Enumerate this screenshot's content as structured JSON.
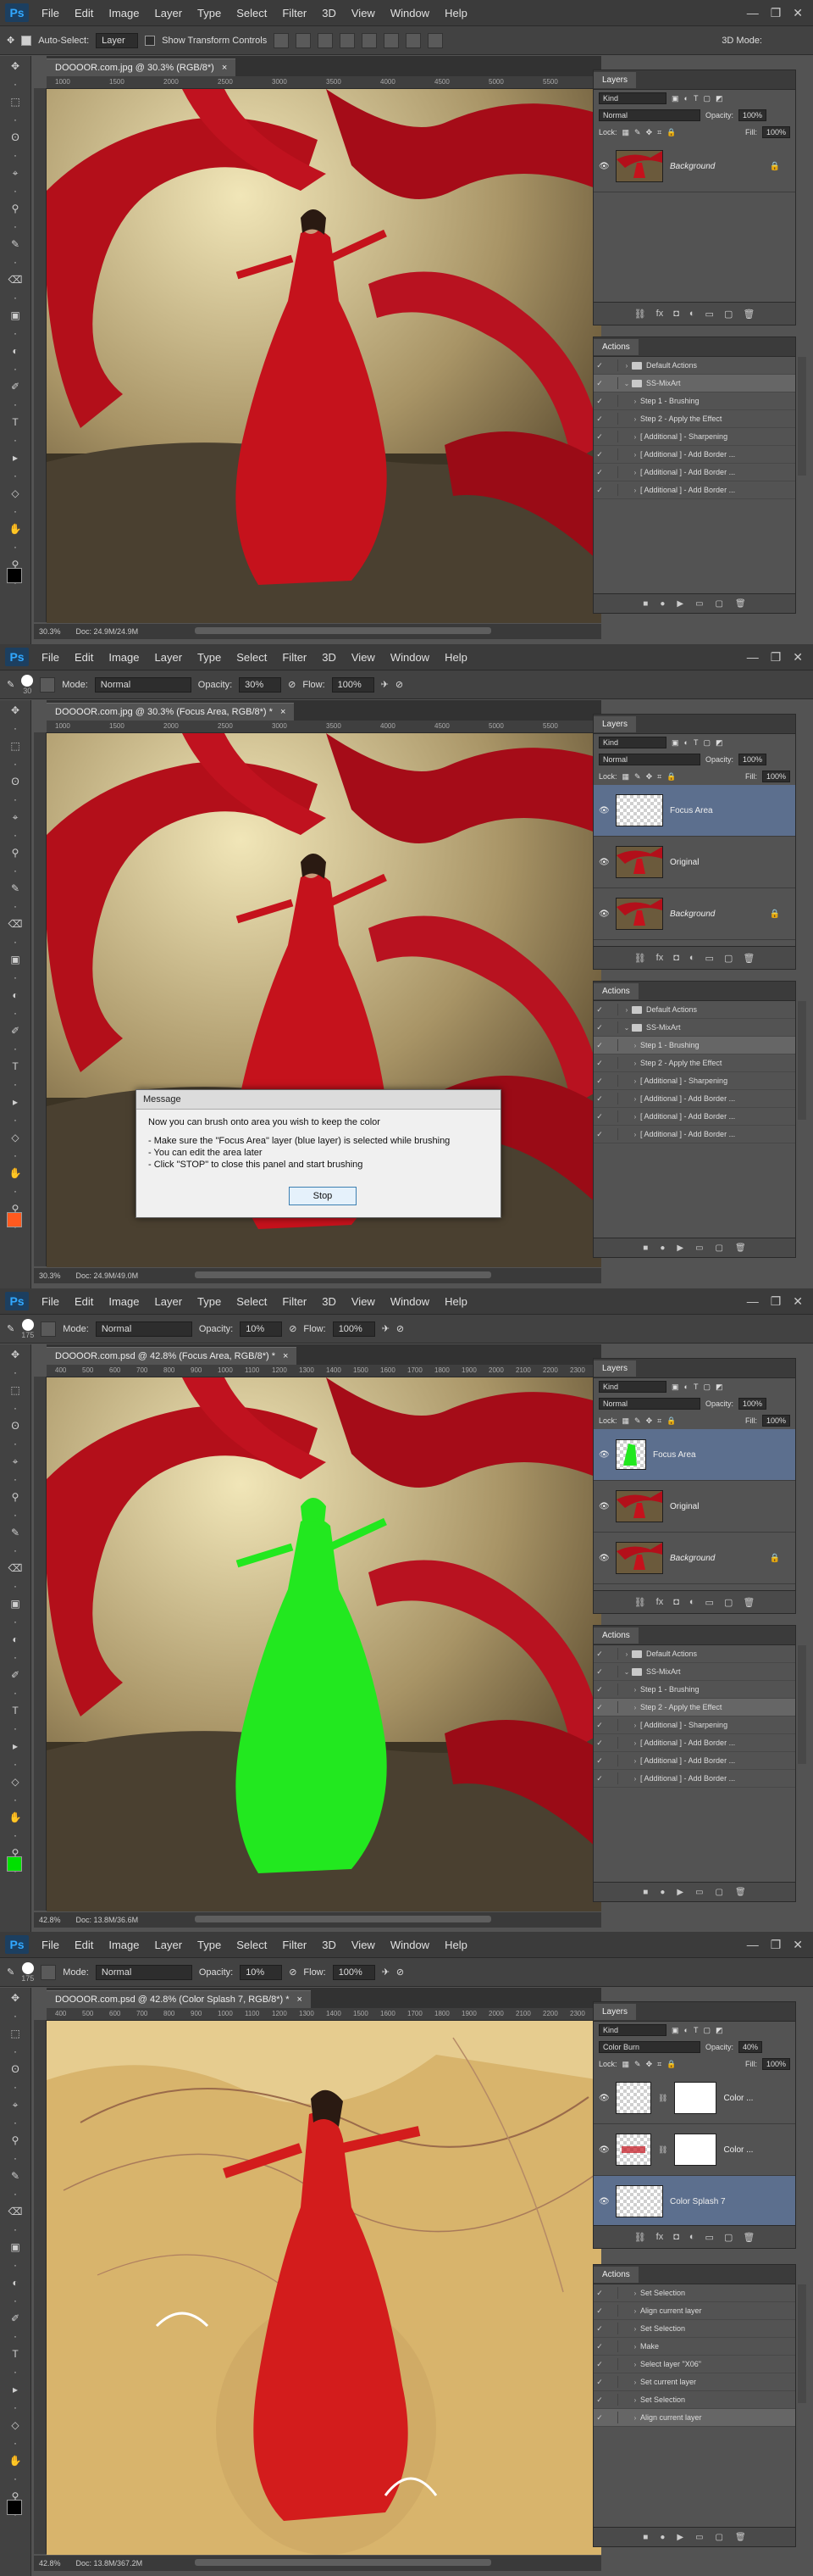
{
  "menu": [
    "File",
    "Edit",
    "Image",
    "Layer",
    "Type",
    "Select",
    "Filter",
    "3D",
    "View",
    "Window",
    "Help"
  ],
  "logo": "Ps",
  "shots": [
    {
      "options": {
        "auto_select": "Auto-Select:",
        "layer": "Layer",
        "transform": "Show Transform Controls",
        "mode3d": "3D Mode:"
      },
      "tab": "DOOOOR.com.jpg @ 30.3% (RGB/8*)",
      "ruler": [
        "1000",
        "1500",
        "2000",
        "2500",
        "3000",
        "3500",
        "4000",
        "4500",
        "5000",
        "5500"
      ],
      "zoom": "30.3%",
      "doc": "Doc: 24.9M/24.9M",
      "layers": {
        "title": "Layers",
        "kind": "Kind",
        "blend": "Normal",
        "opacity_label": "Opacity:",
        "opacity": "100%",
        "lock_label": "Lock:",
        "fill_label": "Fill:",
        "fill": "100%",
        "items": [
          {
            "name": "Background",
            "type": "photo",
            "italic": true,
            "lock": true,
            "sel": false
          }
        ]
      },
      "actions": {
        "title": "Actions",
        "items": [
          {
            "label": "Default Actions",
            "folder": true,
            "arrow": "›",
            "sel": false
          },
          {
            "label": "SS-MixArt",
            "folder": true,
            "arrow": "⌄",
            "sel": true
          },
          {
            "label": "Step 1 - Brushing",
            "folder": false,
            "arrow": "›",
            "sel": false
          },
          {
            "label": "Step 2 - Apply the Effect",
            "folder": false,
            "arrow": "›",
            "sel": false
          },
          {
            "label": "[ Additional ] - Sharpening",
            "folder": false,
            "arrow": "›",
            "sel": false
          },
          {
            "label": "[ Additional ] - Add Border ...",
            "folder": false,
            "arrow": "›",
            "sel": false
          },
          {
            "label": "[ Additional ] - Add Border ...",
            "folder": false,
            "arrow": "›",
            "sel": false
          },
          {
            "label": "[ Additional ] - Add Border ...",
            "folder": false,
            "arrow": "›",
            "sel": false
          }
        ]
      },
      "fg": "#000000",
      "bg": "#ffffff"
    },
    {
      "options": {
        "size": "30",
        "mode_label": "Mode:",
        "mode": "Normal",
        "opacity_label": "Opacity:",
        "opacity": "30%",
        "flow_label": "Flow:",
        "flow": "100%"
      },
      "tab": "DOOOOR.com.jpg @ 30.3% (Focus Area, RGB/8*) *",
      "ruler": [
        "1000",
        "1500",
        "2000",
        "2500",
        "3000",
        "3500",
        "4000",
        "4500",
        "5000",
        "5500"
      ],
      "zoom": "30.3%",
      "doc": "Doc: 24.9M/49.0M",
      "layers": {
        "title": "Layers",
        "kind": "Kind",
        "blend": "Normal",
        "opacity_label": "Opacity:",
        "opacity": "100%",
        "lock_label": "Lock:",
        "fill_label": "Fill:",
        "fill": "100%",
        "items": [
          {
            "name": "Focus Area",
            "type": "checker",
            "italic": false,
            "lock": false,
            "sel": true
          },
          {
            "name": "Original",
            "type": "photo",
            "italic": false,
            "lock": false,
            "sel": false
          },
          {
            "name": "Background",
            "type": "photo",
            "italic": true,
            "lock": true,
            "sel": false
          }
        ]
      },
      "actions": {
        "title": "Actions",
        "items": [
          {
            "label": "Default Actions",
            "folder": true,
            "arrow": "›",
            "sel": false
          },
          {
            "label": "SS-MixArt",
            "folder": true,
            "arrow": "⌄",
            "sel": false
          },
          {
            "label": "Step 1 - Brushing",
            "folder": false,
            "arrow": "›",
            "sel": true
          },
          {
            "label": "Step 2 - Apply the Effect",
            "folder": false,
            "arrow": "›",
            "sel": false
          },
          {
            "label": "[ Additional ] - Sharpening",
            "folder": false,
            "arrow": "›",
            "sel": false
          },
          {
            "label": "[ Additional ] - Add Border ...",
            "folder": false,
            "arrow": "›",
            "sel": false
          },
          {
            "label": "[ Additional ] - Add Border ...",
            "folder": false,
            "arrow": "›",
            "sel": false
          },
          {
            "label": "[ Additional ] - Add Border ...",
            "folder": false,
            "arrow": "›",
            "sel": false
          }
        ]
      },
      "dialog": {
        "title": "Message",
        "lines": [
          "Now you can brush onto area you wish to keep the color",
          "- Make sure the \"Focus Area\" layer (blue layer) is selected while brushing",
          "- You can edit the area later",
          "- Click \"STOP\" to close this panel and start brushing"
        ],
        "button": "Stop"
      },
      "fg": "#ff5a1f",
      "bg": "#ffffff"
    },
    {
      "options": {
        "size": "175",
        "mode_label": "Mode:",
        "mode": "Normal",
        "opacity_label": "Opacity:",
        "opacity": "10%",
        "flow_label": "Flow:",
        "flow": "100%"
      },
      "tab": "DOOOOR.com.psd @ 42.8% (Focus Area, RGB/8*) *",
      "ruler": [
        "400",
        "500",
        "600",
        "700",
        "800",
        "900",
        "1000",
        "1100",
        "1200",
        "1300",
        "1400",
        "1500",
        "1600",
        "1700",
        "1800",
        "1900",
        "2000",
        "2100",
        "2200",
        "2300"
      ],
      "zoom": "42.8%",
      "doc": "Doc: 13.8M/36.6M",
      "layers": {
        "title": "Layers",
        "kind": "Kind",
        "blend": "Normal",
        "opacity_label": "Opacity:",
        "opacity": "100%",
        "lock_label": "Lock:",
        "fill_label": "Fill:",
        "fill": "100%",
        "items": [
          {
            "name": "Focus Area",
            "type": "green",
            "italic": false,
            "lock": false,
            "sel": true
          },
          {
            "name": "Original",
            "type": "photo",
            "italic": false,
            "lock": false,
            "sel": false
          },
          {
            "name": "Background",
            "type": "photo",
            "italic": true,
            "lock": true,
            "sel": false
          }
        ]
      },
      "actions": {
        "title": "Actions",
        "items": [
          {
            "label": "Default Actions",
            "folder": true,
            "arrow": "›",
            "sel": false
          },
          {
            "label": "SS-MixArt",
            "folder": true,
            "arrow": "⌄",
            "sel": false
          },
          {
            "label": "Step 1 - Brushing",
            "folder": false,
            "arrow": "›",
            "sel": false
          },
          {
            "label": "Step 2 - Apply the Effect",
            "folder": false,
            "arrow": "›",
            "sel": true
          },
          {
            "label": "[ Additional ] - Sharpening",
            "folder": false,
            "arrow": "›",
            "sel": false
          },
          {
            "label": "[ Additional ] - Add Border ...",
            "folder": false,
            "arrow": "›",
            "sel": false
          },
          {
            "label": "[ Additional ] - Add Border ...",
            "folder": false,
            "arrow": "›",
            "sel": false
          },
          {
            "label": "[ Additional ] - Add Border ...",
            "folder": false,
            "arrow": "›",
            "sel": false
          }
        ]
      },
      "fg": "#00e000",
      "bg": "#ffffff"
    },
    {
      "options": {
        "size": "175",
        "mode_label": "Mode:",
        "mode": "Normal",
        "opacity_label": "Opacity:",
        "opacity": "10%",
        "flow_label": "Flow:",
        "flow": "100%"
      },
      "tab": "DOOOOR.com.psd @ 42.8% (Color Splash 7, RGB/8*) *",
      "ruler": [
        "400",
        "500",
        "600",
        "700",
        "800",
        "900",
        "1000",
        "1100",
        "1200",
        "1300",
        "1400",
        "1500",
        "1600",
        "1700",
        "1800",
        "1900",
        "2000",
        "2100",
        "2200",
        "2300"
      ],
      "zoom": "42.8%",
      "doc": "Doc: 13.8M/367.2M",
      "layers": {
        "title": "Layers",
        "kind": "Kind",
        "blend": "Color Burn",
        "opacity_label": "Opacity:",
        "opacity": "40%",
        "lock_label": "Lock:",
        "fill_label": "Fill:",
        "fill": "100%",
        "items": [
          {
            "name": "Color ...",
            "type": "mask",
            "italic": false,
            "lock": false,
            "sel": false
          },
          {
            "name": "Color ...",
            "type": "mask2",
            "italic": false,
            "lock": false,
            "sel": false
          },
          {
            "name": "Color Splash 7",
            "type": "checker",
            "italic": false,
            "lock": false,
            "sel": true
          }
        ]
      },
      "actions": {
        "title": "Actions",
        "items": [
          {
            "label": "Set Selection",
            "folder": false,
            "arrow": "›",
            "sel": false
          },
          {
            "label": "Align current layer",
            "folder": false,
            "arrow": "›",
            "sel": false
          },
          {
            "label": "Set Selection",
            "folder": false,
            "arrow": "›",
            "sel": false
          },
          {
            "label": "Make",
            "folder": false,
            "arrow": "›",
            "sel": false
          },
          {
            "label": "Select layer \"X06\"",
            "folder": false,
            "arrow": "›",
            "sel": false
          },
          {
            "label": "Set current layer",
            "folder": false,
            "arrow": "›",
            "sel": false
          },
          {
            "label": "Set Selection",
            "folder": false,
            "arrow": "›",
            "sel": false
          },
          {
            "label": "Align current layer",
            "folder": false,
            "arrow": "›",
            "sel": true
          }
        ]
      },
      "fg": "#000000",
      "bg": "#ffffff"
    }
  ]
}
